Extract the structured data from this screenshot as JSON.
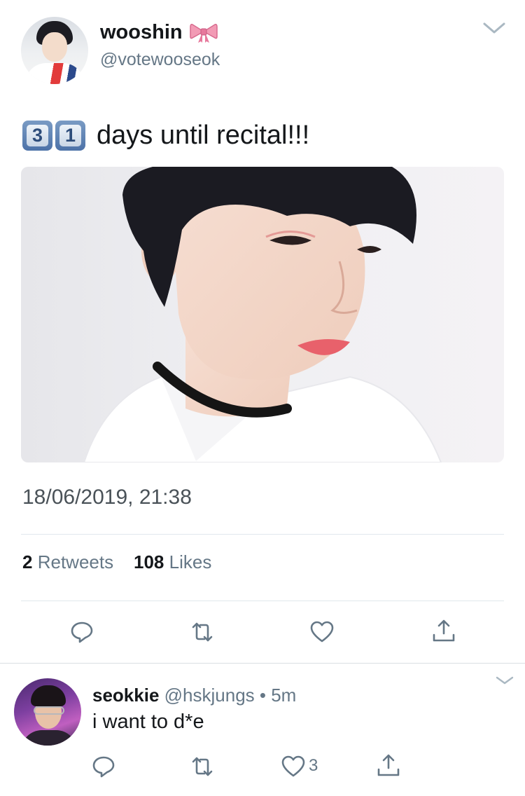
{
  "tweet": {
    "author": {
      "display_name": "wooshin",
      "name_emoji": "ribbon-bow",
      "handle": "@votewooseok",
      "avatar": "profile-photo"
    },
    "text": {
      "keycaps": [
        "3",
        "1"
      ],
      "body": "days until recital!!!"
    },
    "image": "photo",
    "timestamp": "18/06/2019, 21:38",
    "stats": {
      "retweets_count": "2",
      "retweets_label": "Retweets",
      "likes_count": "108",
      "likes_label": "Likes"
    },
    "actions": [
      {
        "icon": "reply-icon"
      },
      {
        "icon": "retweet-icon"
      },
      {
        "icon": "heart-icon"
      },
      {
        "icon": "share-icon"
      }
    ]
  },
  "reply": {
    "display_name": "seokkie",
    "meta": "@hskjungs • 5m",
    "text": "i want to d*e",
    "like_count": "3",
    "actions": [
      {
        "icon": "reply-icon"
      },
      {
        "icon": "retweet-icon"
      },
      {
        "icon": "heart-icon"
      },
      {
        "icon": "share-icon"
      }
    ]
  },
  "colors": {
    "text_primary": "#14171a",
    "text_secondary": "#657786",
    "divider": "#e1e8ed",
    "keycap": "#4c72a8",
    "bow": "#f29bb5"
  }
}
